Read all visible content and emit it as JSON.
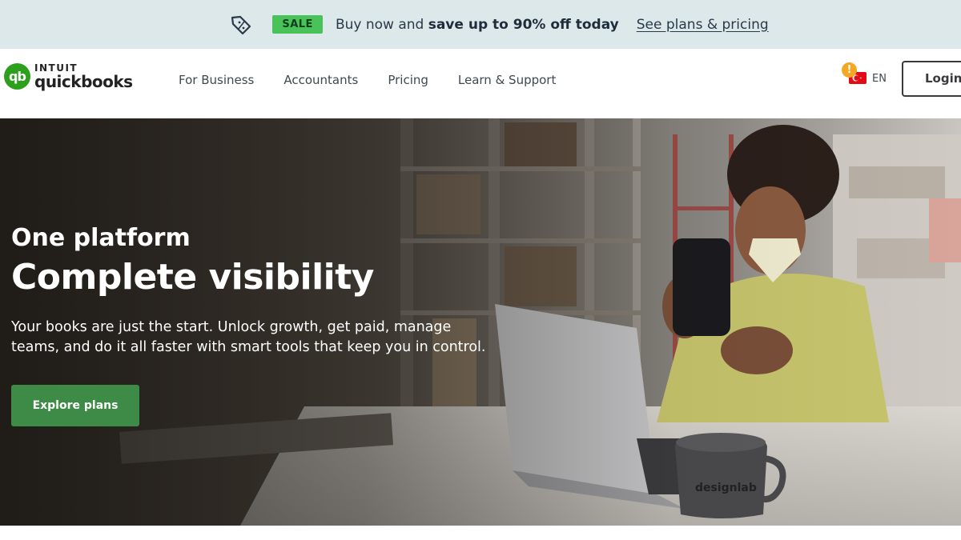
{
  "promo": {
    "badge": "SALE",
    "text_lead": "Buy now and",
    "text_bold": "save up to 90% off today",
    "link": "See plans & pricing",
    "icon": "discount-tag-icon",
    "badge_color": "#4ac25a"
  },
  "header": {
    "logo": {
      "brand_top": "INTUIT",
      "brand_main": "quickbooks",
      "mark": "qb"
    },
    "nav": [
      {
        "label": "For Business"
      },
      {
        "label": "Accountants"
      },
      {
        "label": "Pricing"
      },
      {
        "label": "Learn & Support"
      }
    ],
    "language": {
      "label": "EN",
      "alert": "!",
      "flag_icon": "turkey-flag-icon"
    },
    "login_label": "Login"
  },
  "hero": {
    "subtitle": "One platform",
    "title": "Complete visibility",
    "body": "Your books are just the start. Unlock growth, get paid, manage teams, and do it all faster with smart tools that keep you in control.",
    "cta_label": "Explore plans",
    "cta_color": "#3e8a47",
    "mug_text": "designlab"
  }
}
